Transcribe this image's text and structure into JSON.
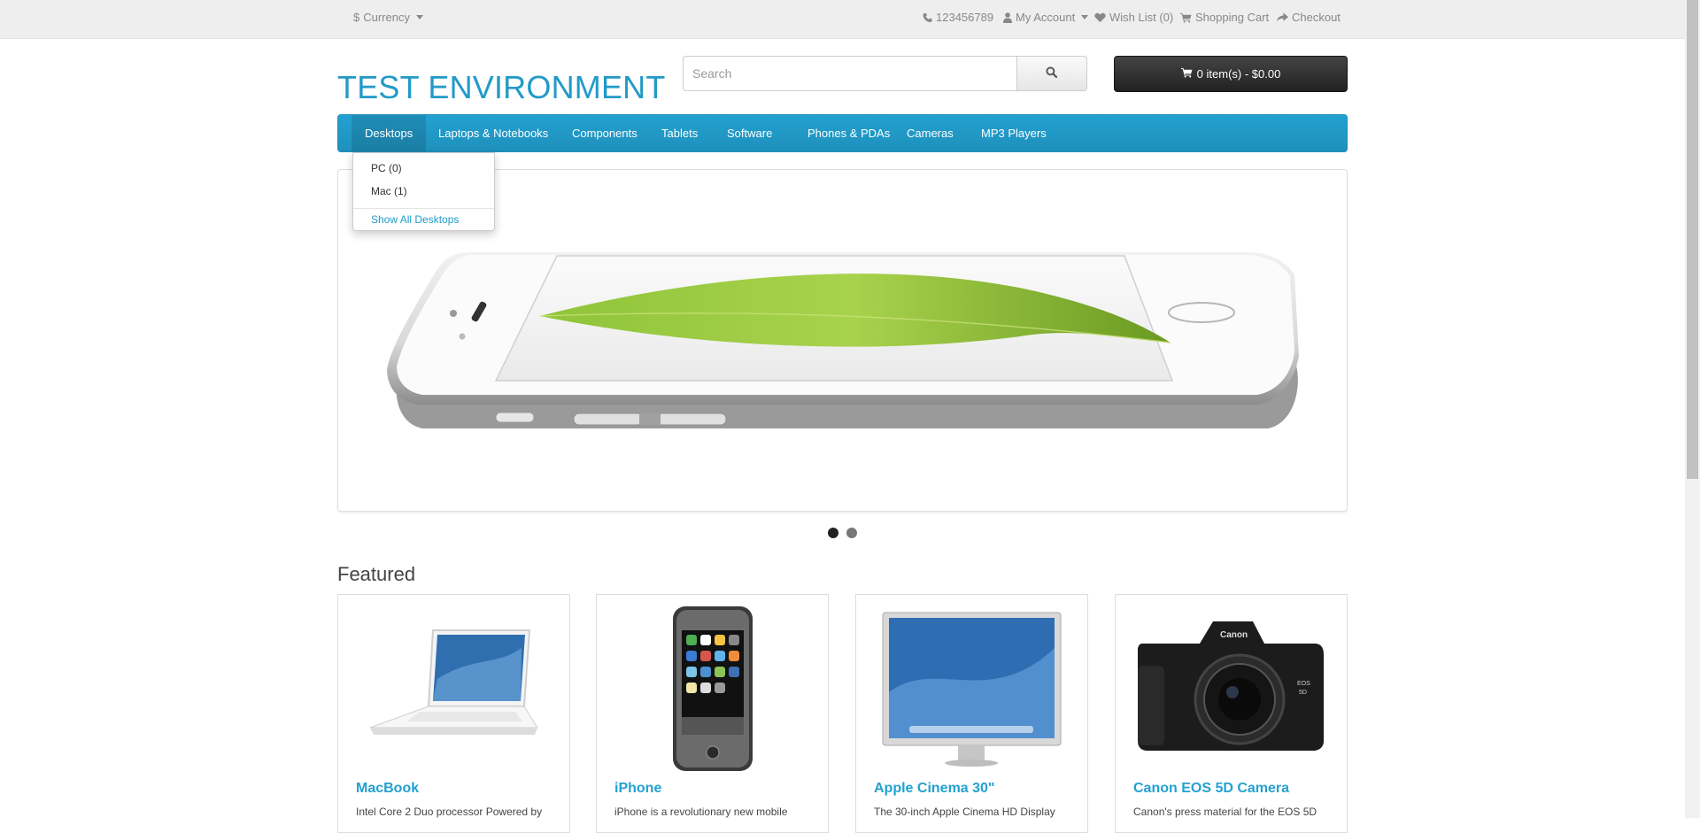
{
  "topbar": {
    "currency_symbol": "$",
    "currency_label": "Currency",
    "phone": "123456789",
    "my_account": "My Account",
    "wishlist": "Wish List (0)",
    "shopping_cart": "Shopping Cart",
    "checkout": "Checkout"
  },
  "header": {
    "logo": "TEST ENVIRONMENT",
    "search_placeholder": "Search",
    "cart_label": "0 item(s) - $0.00"
  },
  "menu": {
    "items": [
      "Desktops",
      "Laptops & Notebooks",
      "Components",
      "Tablets",
      "Software",
      "Phones & PDAs",
      "Cameras",
      "MP3 Players"
    ],
    "active": "Desktops"
  },
  "dropdown": {
    "items": [
      "PC (0)",
      "Mac (1)"
    ],
    "show_all": "Show All Desktops"
  },
  "slideshow": {
    "slide_count": 2,
    "active_slide": 1
  },
  "featured": {
    "title": "Featured",
    "products": [
      {
        "name": "MacBook",
        "desc": "Intel Core 2 Duo processor Powered by"
      },
      {
        "name": "iPhone",
        "desc": "iPhone is a revolutionary new mobile"
      },
      {
        "name": "Apple Cinema 30\"",
        "desc": "The 30-inch Apple Cinema HD Display"
      },
      {
        "name": "Canon EOS 5D Camera",
        "desc": "Canon's press material for the EOS 5D"
      }
    ]
  },
  "colors": {
    "brand_blue": "#229ac8",
    "menu_blue": "#1f90bb",
    "cart_dark": "#303030",
    "topbar_bg": "#eeeeee"
  },
  "icons": [
    "phone-icon",
    "user-icon",
    "heart-icon",
    "cart-icon",
    "share-icon",
    "search-icon"
  ]
}
